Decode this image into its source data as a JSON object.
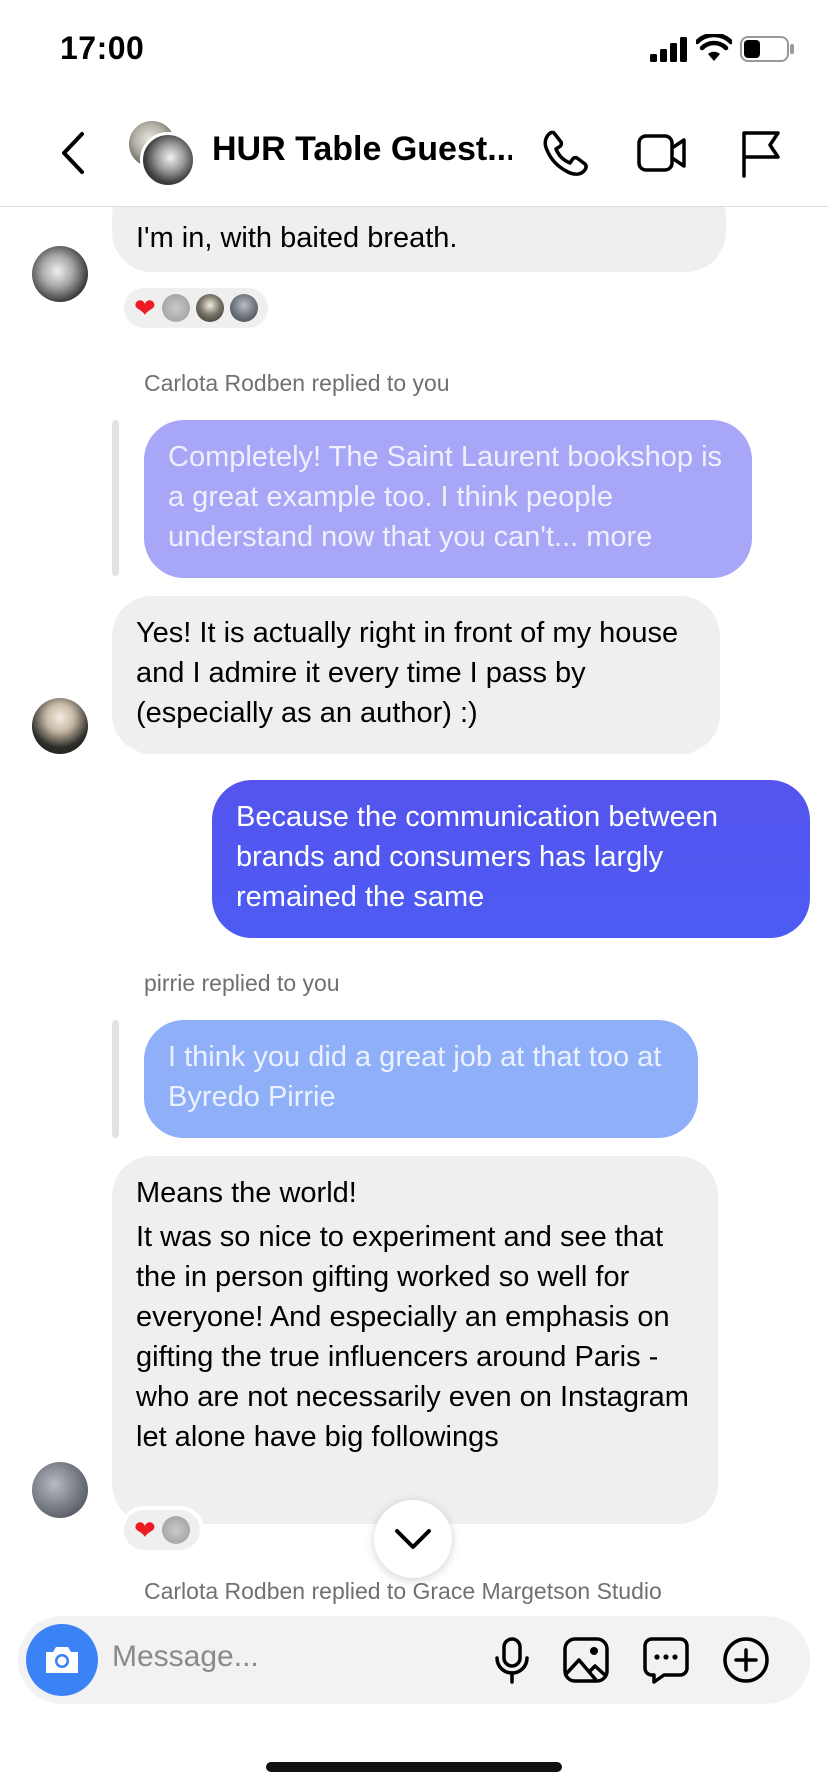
{
  "status_bar": {
    "time": "17:00"
  },
  "header": {
    "title": "HUR Table Guest..."
  },
  "messages": {
    "m1": {
      "text": "I'm in, with baited breath.",
      "reactions": [
        "heart",
        "avatar",
        "avatar",
        "avatar"
      ]
    },
    "r1": {
      "meta": "Carlota Rodben replied to you",
      "quoted": "Completely! The Saint Laurent bookshop is a great example too. I think people understand now that you can't... more",
      "reply": "Yes! It is actually right in front of my house and I admire it every time I pass by (especially as an author) :)"
    },
    "m2": {
      "text": "Because the communication between brands and consumers has largly remained the same"
    },
    "r2": {
      "meta": "pirrie replied to you",
      "quoted": "I think you did a great job at that too at Byredo Pirrie",
      "reply_line1": "Means the world!",
      "reply_line2": "It was so nice to experiment and see that the in person gifting worked so well for everyone! And especially an emphasis on gifting the true influencers around Paris - who are not necessarily even on Instagram let alone have big followings",
      "reactions": [
        "heart",
        "avatar"
      ]
    },
    "r3": {
      "meta": "Carlota Rodben replied to Grace Margetson Studio"
    }
  },
  "composer": {
    "placeholder": "Message..."
  },
  "colors": {
    "accent": "#4f55f0",
    "quote_purple": "#a8a6f6",
    "quote_blue": "#8faff8",
    "incoming": "#efefef",
    "camera": "#3b82f6"
  },
  "icons": [
    "back-icon",
    "phone-icon",
    "video-icon",
    "flag-icon",
    "chevron-down-icon",
    "camera-icon",
    "microphone-icon",
    "image-icon",
    "sticker-icon",
    "plus-icon"
  ]
}
